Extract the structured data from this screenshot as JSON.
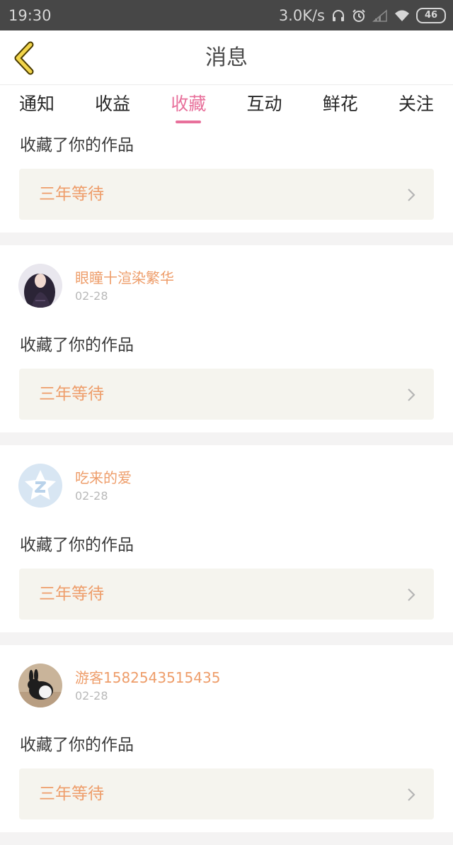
{
  "status_bar": {
    "time": "19:30",
    "net_speed": "3.0K/s",
    "battery": "46",
    "icons": [
      "headphones-icon",
      "alarm-icon",
      "signal-icon",
      "wifi-icon",
      "battery-icon"
    ]
  },
  "header": {
    "title": "消息",
    "back_icon": "chevron-left-icon",
    "accent_color": "#e8c93a"
  },
  "tabs": [
    {
      "label": "通知",
      "active": false
    },
    {
      "label": "收益",
      "active": false
    },
    {
      "label": "收藏",
      "active": true
    },
    {
      "label": "互动",
      "active": false
    },
    {
      "label": "鲜花",
      "active": false
    },
    {
      "label": "关注",
      "active": false
    }
  ],
  "colors": {
    "active_tab": "#e8709b",
    "username": "#ee9d6a",
    "work_title": "#ee9d6a",
    "work_bg": "#f5f4ee"
  },
  "partial_item": {
    "action": "收藏了你的作品",
    "work_title": "三年等待"
  },
  "items": [
    {
      "username": "眼瞳十渲染繁华",
      "date": "02-28",
      "action": "收藏了你的作品",
      "work_title": "三年等待",
      "avatar": "girl-photo-avatar"
    },
    {
      "username": "吃来的爱",
      "date": "02-28",
      "action": "收藏了你的作品",
      "work_title": "三年等待",
      "avatar": "default-star-avatar"
    },
    {
      "username": "游客1582543515435",
      "date": "02-28",
      "action": "收藏了你的作品",
      "work_title": "三年等待",
      "avatar": "rabbit-photo-avatar"
    }
  ]
}
